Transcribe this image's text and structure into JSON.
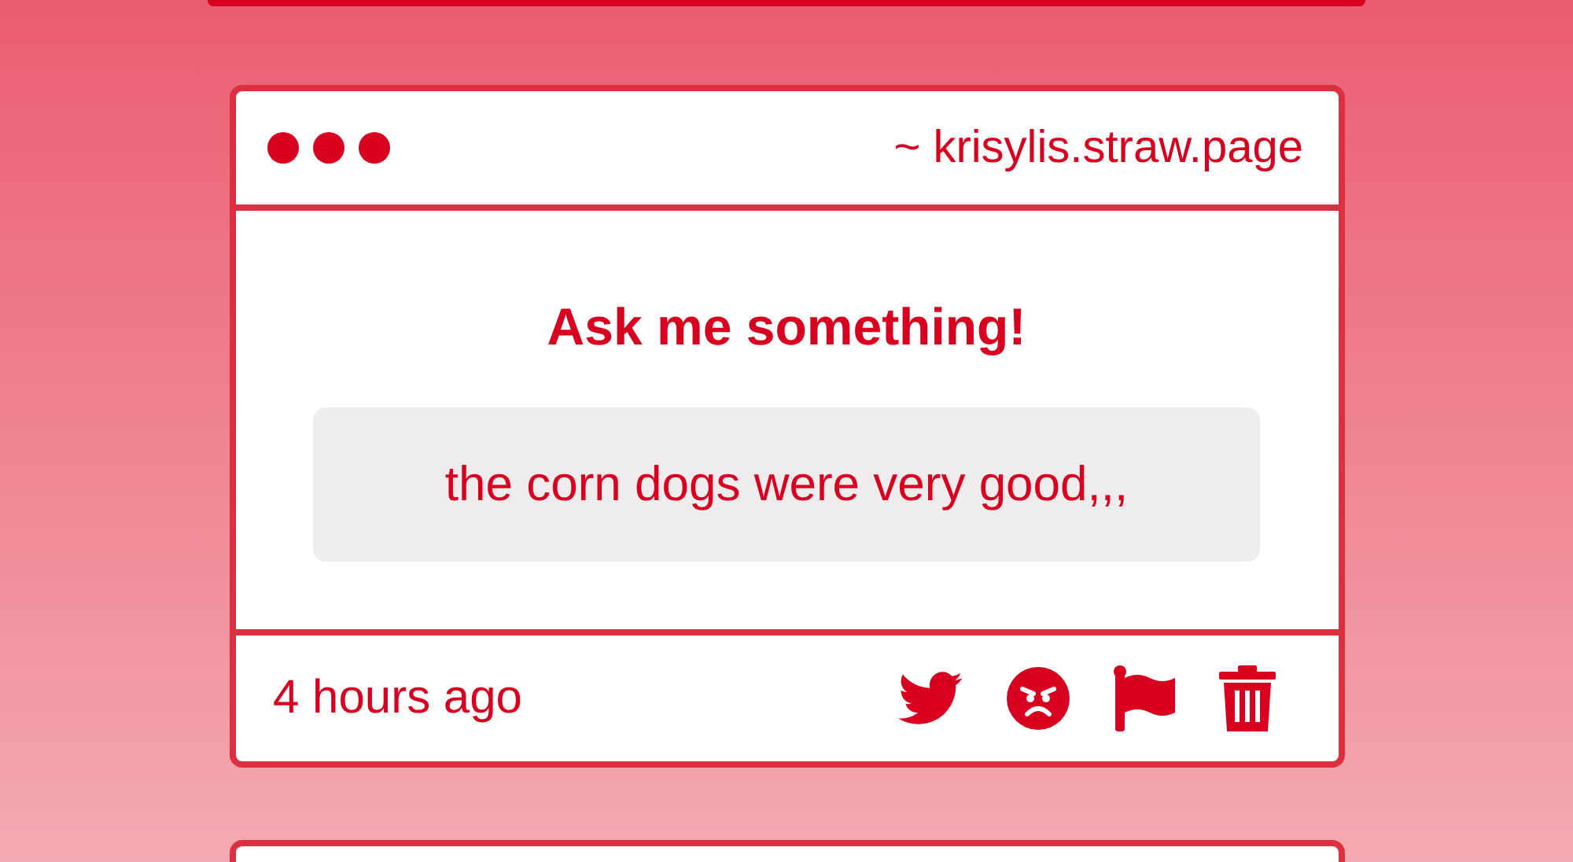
{
  "card": {
    "site": "~ krisylis.straw.page",
    "heading": "Ask me something!",
    "question": "the corn dogs were very good,,,",
    "time": "4 hours ago"
  }
}
